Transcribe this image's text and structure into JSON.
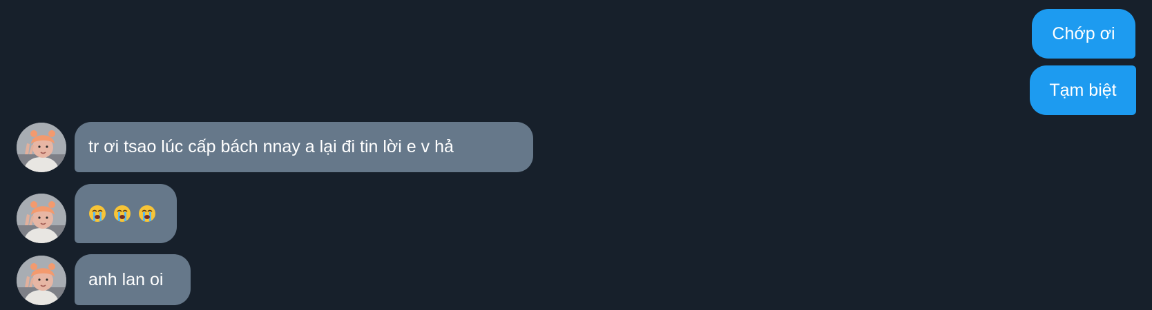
{
  "conversation": {
    "outgoing": [
      {
        "text": "Chớp ơi"
      },
      {
        "text": "Tạm biệt"
      }
    ],
    "incoming": [
      {
        "text": "tr ơi tsao lúc cấp bách nnay a lại đi tin lời e v hả"
      },
      {
        "emoji": [
          "loudly-crying-face",
          "loudly-crying-face",
          "loudly-crying-face"
        ]
      },
      {
        "text": "anh lan oi"
      }
    ]
  },
  "colors": {
    "background": "#17202b",
    "outgoing_bubble": "#1d9bf0",
    "incoming_bubble": "#66788a",
    "text": "#ffffff"
  },
  "icons": {
    "avatar": "user-avatar-photo",
    "emoji": "loudly-crying-face"
  }
}
